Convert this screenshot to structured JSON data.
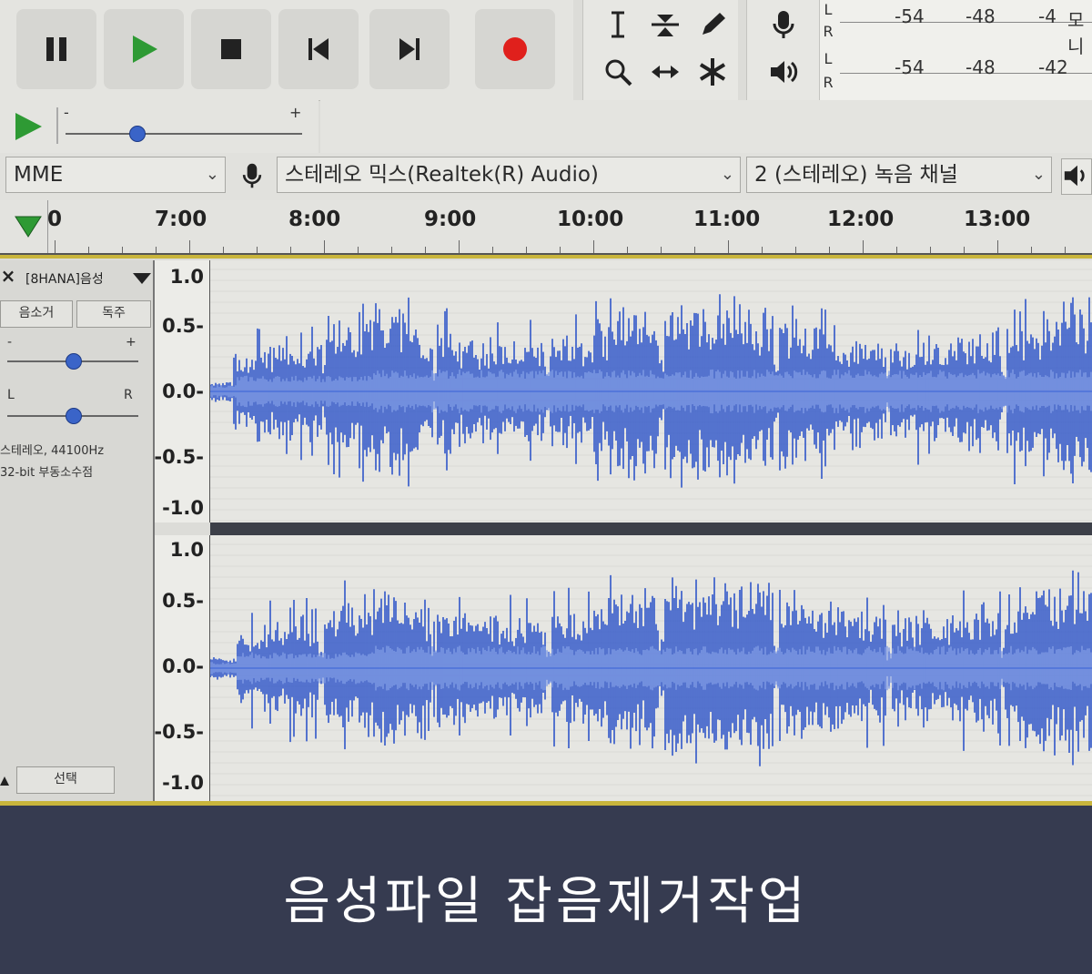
{
  "transport": {
    "buttons": [
      "pause-button",
      "play-button",
      "stop-button",
      "skip-to-start-button",
      "skip-to-end-button",
      "record-button"
    ]
  },
  "meters": {
    "record": {
      "channels": [
        "L",
        "R"
      ],
      "ticks": [
        "-54",
        "-48",
        "-4"
      ],
      "extra": "모니"
    },
    "playback": {
      "channels": [
        "L",
        "R"
      ],
      "ticks": [
        "-54",
        "-48",
        "-42"
      ]
    }
  },
  "speed": {
    "minus": "-",
    "plus": "+",
    "value": 0.3
  },
  "device": {
    "host": "MME",
    "input": "스테레오 믹스(Realtek(R) Audio)",
    "channels": "2 (스테레오) 녹음 채널"
  },
  "ruler": {
    "labels": [
      "0",
      "7:00",
      "8:00",
      "9:00",
      "10:00",
      "11:00",
      "12:00",
      "13:00"
    ]
  },
  "track": {
    "name": "[8HANA]음성",
    "mute": "음소거",
    "solo": "독주",
    "gain_minus": "-",
    "gain_plus": "+",
    "gain_value": 0.5,
    "pan_left": "L",
    "pan_right": "R",
    "pan_value": 0.5,
    "info_line1": "스테레오, 44100Hz",
    "info_line2": "32-bit 부동소수점",
    "select": "선택"
  },
  "scale_top": [
    "1.0",
    "0.5-",
    "0.0-",
    "-0.5-",
    "-1.0"
  ],
  "scale_bottom": [
    "1.0",
    "0.5-",
    "0.0-",
    "-0.5-",
    "-1.0"
  ],
  "caption": "음성파일 잡음제거작업",
  "colors": {
    "waveform": "#2f56c9",
    "caption_band": "#363b50",
    "record": "#e0201c",
    "play": "#2e9a34"
  }
}
